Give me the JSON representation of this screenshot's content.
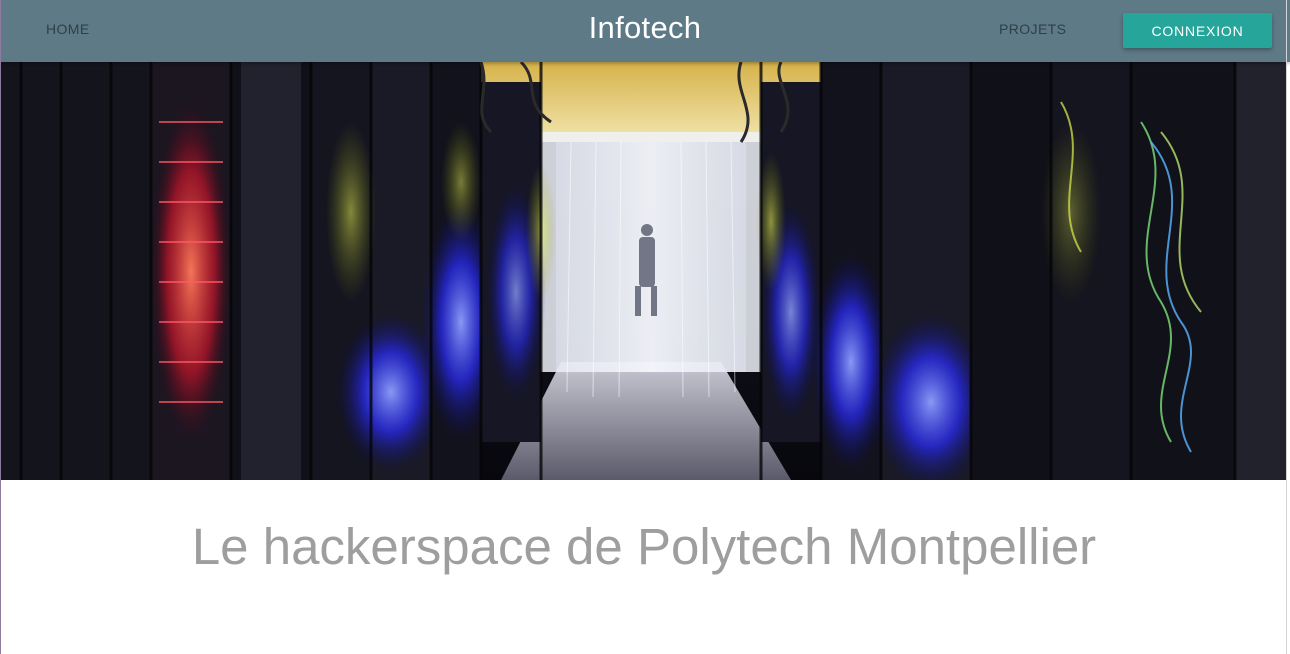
{
  "navbar": {
    "home_label": "HOME",
    "brand": "Infotech",
    "projects_label": "PROJETS",
    "login_label": "CONNEXION",
    "bg_color": "#5e7a87",
    "button_color": "#26a69a"
  },
  "hero": {
    "image_icon": "datacenter-corridor-photo"
  },
  "main": {
    "tagline": "Le hackerspace de Polytech Montpellier"
  }
}
